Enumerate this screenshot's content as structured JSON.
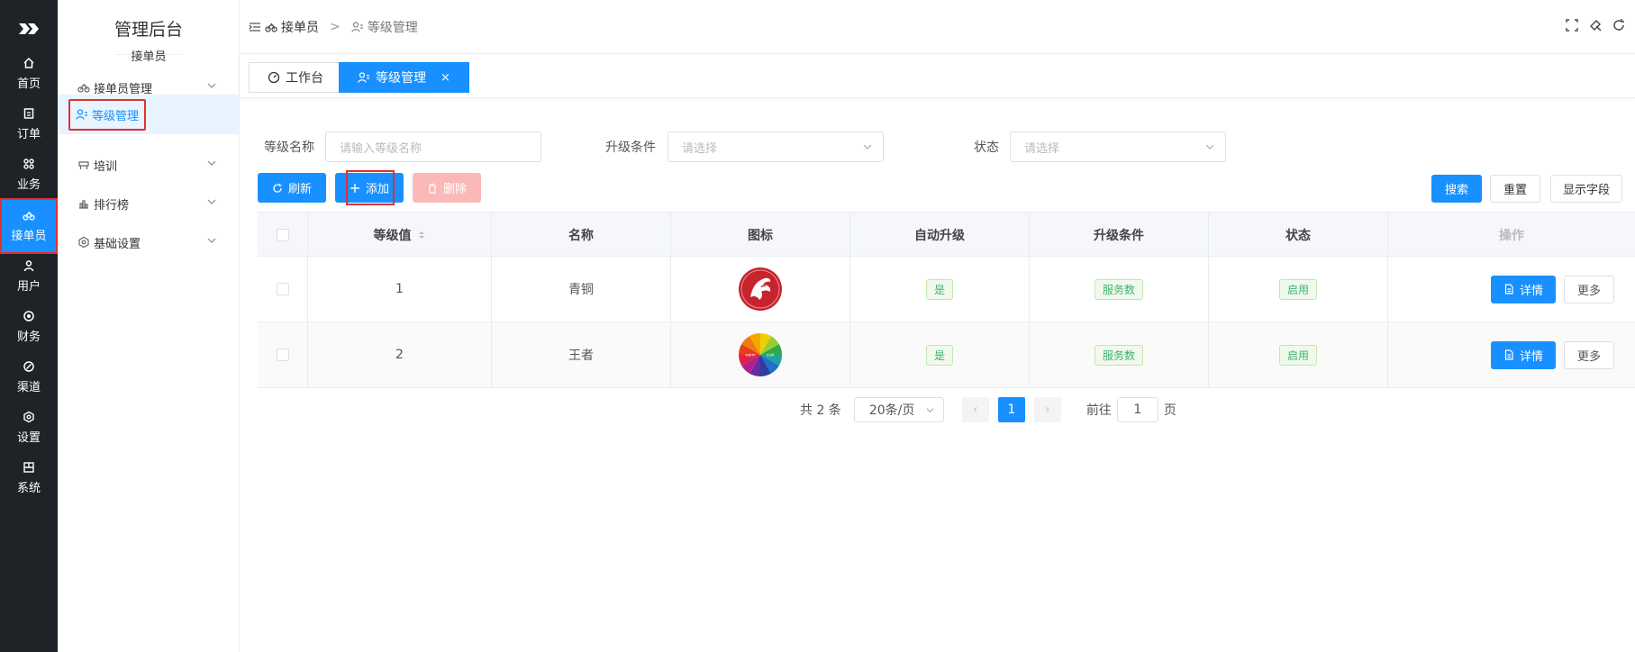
{
  "rail": {
    "items": [
      {
        "label": "首页",
        "icon": "home-icon"
      },
      {
        "label": "订单",
        "icon": "order-icon"
      },
      {
        "label": "业务",
        "icon": "business-icon"
      },
      {
        "label": "接单员",
        "icon": "bike-icon",
        "active": true
      },
      {
        "label": "用户",
        "icon": "user-icon"
      },
      {
        "label": "财务",
        "icon": "finance-icon"
      },
      {
        "label": "渠道",
        "icon": "channel-icon"
      },
      {
        "label": "设置",
        "icon": "settings-icon"
      },
      {
        "label": "系统",
        "icon": "system-icon"
      }
    ]
  },
  "sidebar": {
    "title": "管理后台",
    "subtitle": "接单员",
    "items": [
      {
        "label": "接单员管理"
      },
      {
        "label": "等级管理"
      },
      {
        "label": "培训"
      },
      {
        "label": "排行榜"
      },
      {
        "label": "基础设置"
      }
    ]
  },
  "breadcrumb": {
    "parent": "接单员",
    "separator": ">",
    "current": "等级管理"
  },
  "tabs": [
    {
      "label": "工作台"
    },
    {
      "label": "等级管理",
      "close": "×"
    }
  ],
  "filters": {
    "level_name_label": "等级名称",
    "level_name_placeholder": "请输入等级名称",
    "condition_label": "升级条件",
    "condition_placeholder": "请选择",
    "status_label": "状态",
    "status_placeholder": "请选择"
  },
  "toolbar": {
    "refresh": "刷新",
    "add": "添加",
    "delete": "删除",
    "search": "搜索",
    "reset": "重置",
    "columns": "显示字段"
  },
  "table": {
    "headers": [
      "等级值",
      "名称",
      "图标",
      "自动升级",
      "升级条件",
      "状态",
      "操作"
    ],
    "rows": [
      {
        "level": "1",
        "name": "青铜",
        "auto": "是",
        "condition": "服务数",
        "status": "启用",
        "detail": "详情",
        "more": "更多"
      },
      {
        "level": "2",
        "name": "王者",
        "auto": "是",
        "condition": "服务数",
        "status": "启用",
        "detail": "详情",
        "more": "更多"
      }
    ]
  },
  "icon_labels": {
    "warm": "warm",
    "cool": "cool"
  },
  "pagination": {
    "total": "共 2 条",
    "page_size": "20条/页",
    "prev": "‹",
    "current": "1",
    "next": "›",
    "goto_label": "前往",
    "goto_value": "1",
    "page_unit": "页"
  },
  "colors": {
    "primary": "#1890ff",
    "rail_bg": "#1f2328",
    "highlight": "#e03030",
    "success": "#3cb371"
  }
}
